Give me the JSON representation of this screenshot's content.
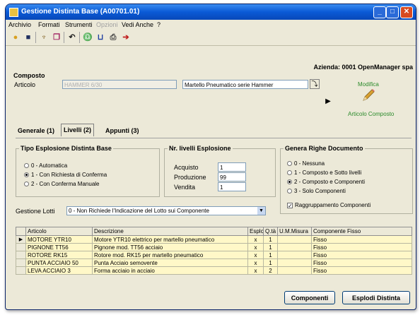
{
  "window": {
    "title": "Gestione Distinta Base (A00701.01)"
  },
  "menu": [
    "Archivio",
    "Formati",
    "Strumenti",
    "Opzioni",
    "Vedi Anche",
    "?"
  ],
  "company": "Azienda: 0001 OpenManager spa",
  "composto": {
    "group_label": "Composto",
    "articolo_label": "Articolo",
    "articolo_code": "HAMMER 6/30",
    "articolo_desc": "Martello Pneumatico serie Hammer",
    "modifica_label": "Modifica",
    "articolo_composto_label": "Articolo Composto"
  },
  "tabs": [
    "Generale (1)",
    "Livelli (2)",
    "Appunti (3)"
  ],
  "tipo_esplosione": {
    "title": "Tipo Esplosione Distinta Base",
    "options": [
      "0 - Automatica",
      "1 - Con Richiesta di Conferma",
      "2 - Con Conferma Manuale"
    ],
    "selected": 1
  },
  "livelli": {
    "title": "Nr. livelli Esplosione",
    "fields": [
      {
        "label": "Acquisto",
        "value": "1"
      },
      {
        "label": "Produzione",
        "value": "99"
      },
      {
        "label": "Vendita",
        "value": "1"
      }
    ]
  },
  "righe": {
    "title": "Genera Righe Documento",
    "options": [
      "0 - Nessuna",
      "1 - Composto e Sotto livelli",
      "2 - Composto e Componenti",
      "3 - Solo Componenti"
    ],
    "selected": 2,
    "checkbox_label": "Raggruppamento Componenti",
    "checked": true
  },
  "gestione_lotti": {
    "label": "Gestione Lotti",
    "value": "0 - Non Richiede l'Indicazione del Lotto sui Componente"
  },
  "table": {
    "headers": [
      "Articolo",
      "Descrizione",
      "Esplo",
      "Q.tà",
      "U.M.Misura",
      "Componente Fisso"
    ],
    "rows": [
      [
        "MOTORE YTR10",
        "Motore YTR10 elettrico per martello pneumatico",
        "x",
        "1",
        "",
        "Fisso"
      ],
      [
        "PIGNONE TT56",
        "Pignone mod. TT56 acciaio",
        "x",
        "1",
        "",
        "Fisso"
      ],
      [
        "ROTORE RK15",
        "Rotore mod. RK15 per martello pneumatico",
        "x",
        "1",
        "",
        "Fisso"
      ],
      [
        "PUNTA ACCIAIO 50",
        "Punta Acciaio semovente",
        "x",
        "1",
        "",
        "Fisso"
      ],
      [
        "LEVA ACCIAIO 3",
        "Forma acciaio in acciaio",
        "x",
        "2",
        "",
        "Fisso"
      ]
    ]
  },
  "buttons": {
    "componenti": "Componenti",
    "esplodi": "Esplodi Distinta"
  },
  "toolbar_icons": [
    "open-icon",
    "save-icon",
    "broom-icon",
    "copy-icon",
    "undo-icon",
    "binoculars-icon",
    "bracket-icon",
    "print-icon",
    "exit-icon"
  ]
}
